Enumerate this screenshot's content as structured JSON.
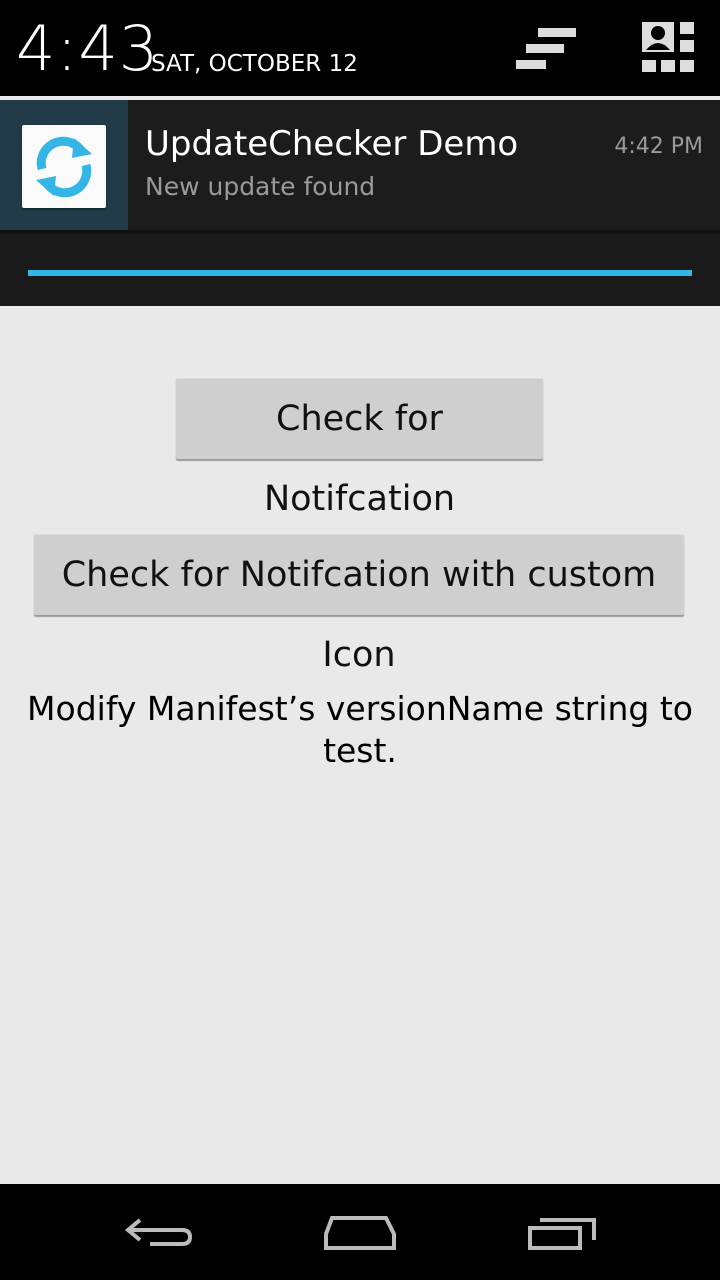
{
  "status": {
    "time": "4:43",
    "date": "SAT, OCTOBER 12"
  },
  "notification": {
    "app_title": "UpdateChecker Demo",
    "text": "New update found",
    "time": "4:42 PM",
    "icon": "sync-icon",
    "progress": 1.0,
    "accent_color": "#33b5e5"
  },
  "main": {
    "button1_label": "Check for Notifcation",
    "button2_label": "Check for Notifcation with custom Icon",
    "info_text": "Modify Manifest’s versionName string to test."
  },
  "navbar": {
    "icons": [
      "back-icon",
      "home-icon",
      "recent-apps-icon"
    ]
  }
}
